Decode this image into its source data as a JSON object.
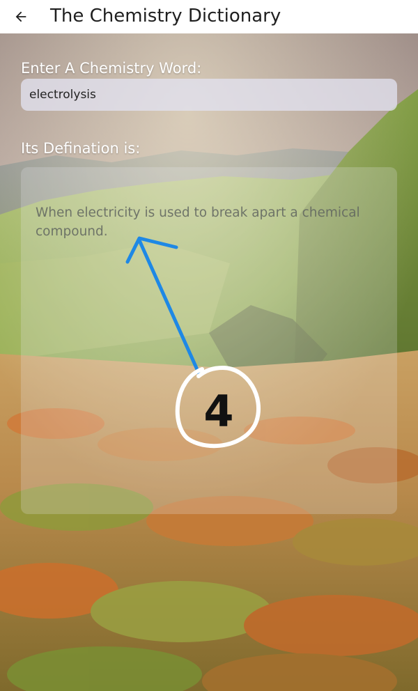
{
  "app_bar": {
    "back_icon": "arrow-back-icon",
    "title": "The Chemistry Dictionary"
  },
  "form": {
    "word_label": "Enter A Chemistry Word:",
    "word_value": "electrolysis",
    "definition_label": "Its Defination is:",
    "definition_text": "When electricity is used to break apart a chemical compound."
  },
  "annotation": {
    "marker_text": "4",
    "arrow_color": "#1e88e5"
  },
  "colors": {
    "app_bar_bg": "#ffffff",
    "label_text": "#ffffff",
    "sky": "#b7aaa6",
    "grass_green": "#8aa84a",
    "grass_orange": "#c2783a"
  }
}
